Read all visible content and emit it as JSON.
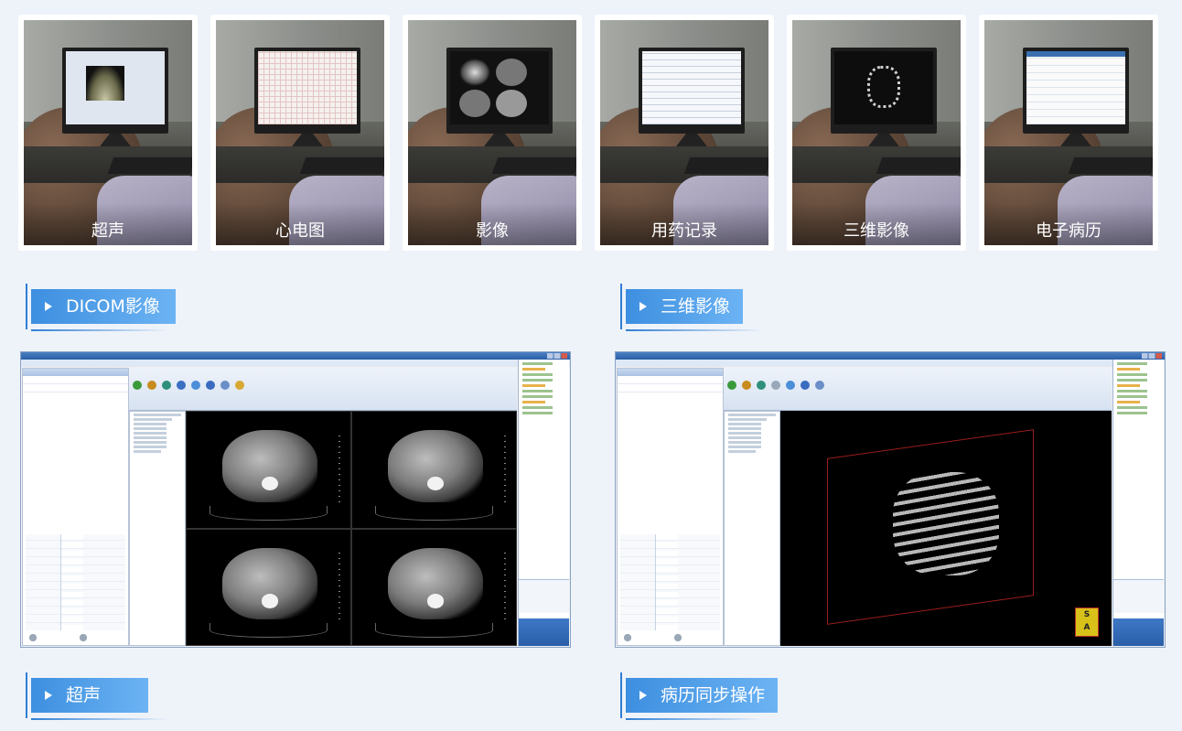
{
  "thumbnails": [
    {
      "label": "超声"
    },
    {
      "label": "心电图"
    },
    {
      "label": "影像"
    },
    {
      "label": "用药记录"
    },
    {
      "label": "三维影像"
    },
    {
      "label": "电子病历"
    }
  ],
  "sections": {
    "dicom": "DICOM影像",
    "three_d": "三维影像",
    "ultrasound": "超声",
    "emr_sync": "病历同步操作"
  },
  "colors": {
    "background": "#eef3fa",
    "tag_start": "#3d8fe0",
    "tag_end": "#6cb3f3"
  }
}
